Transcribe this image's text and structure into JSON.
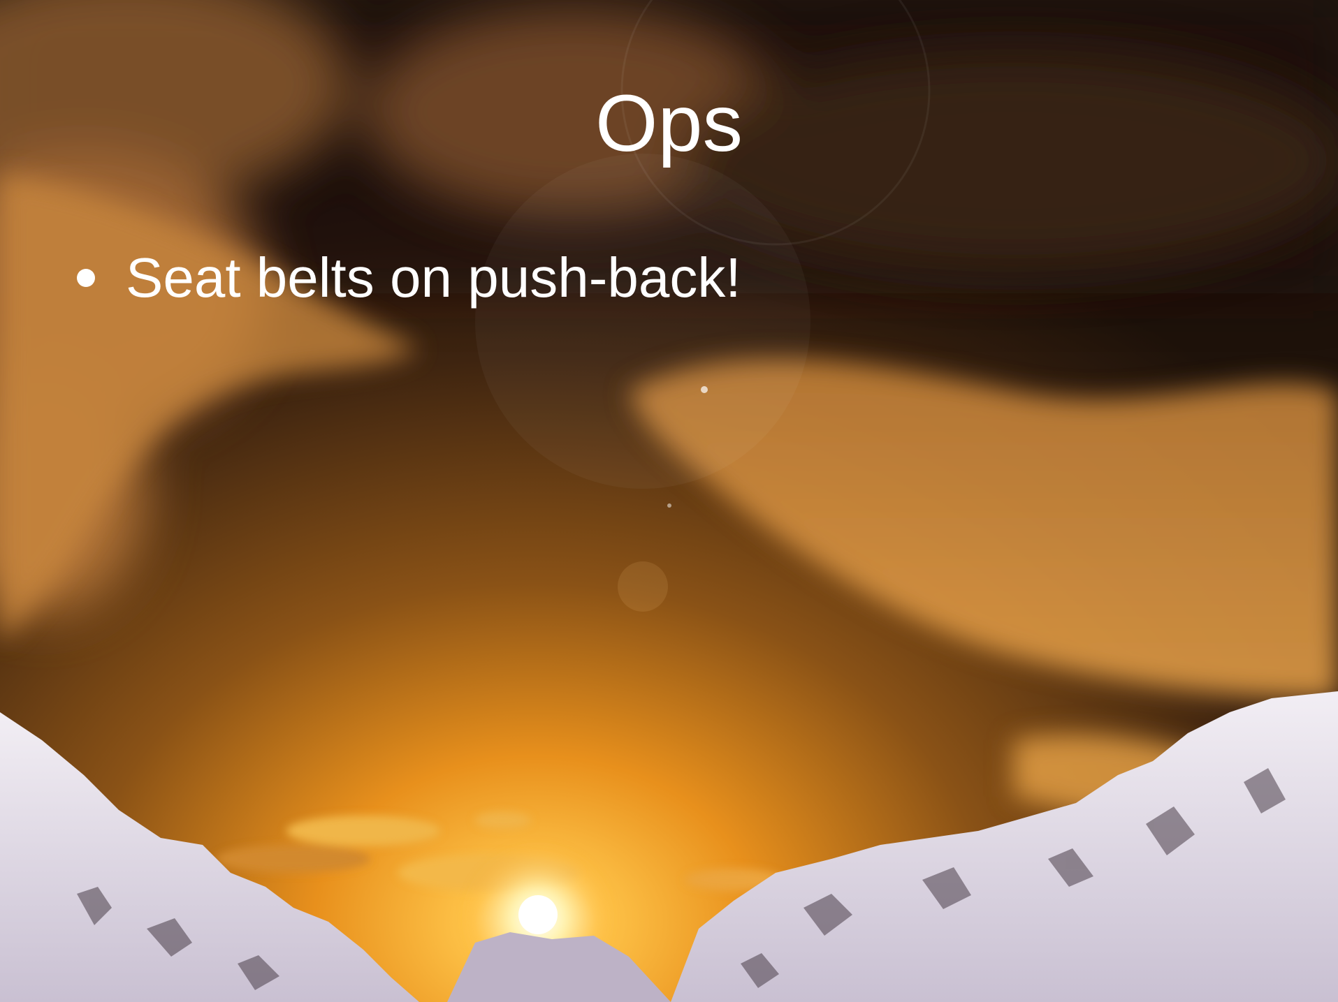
{
  "slide": {
    "title": "Ops",
    "bullets": [
      "Seat belts on push-back!"
    ]
  },
  "colors": {
    "text": "#ffffff",
    "sky_glow": "#f0a030",
    "sky_dark": "#2a1a0c",
    "snow": "#e6e2ec"
  }
}
